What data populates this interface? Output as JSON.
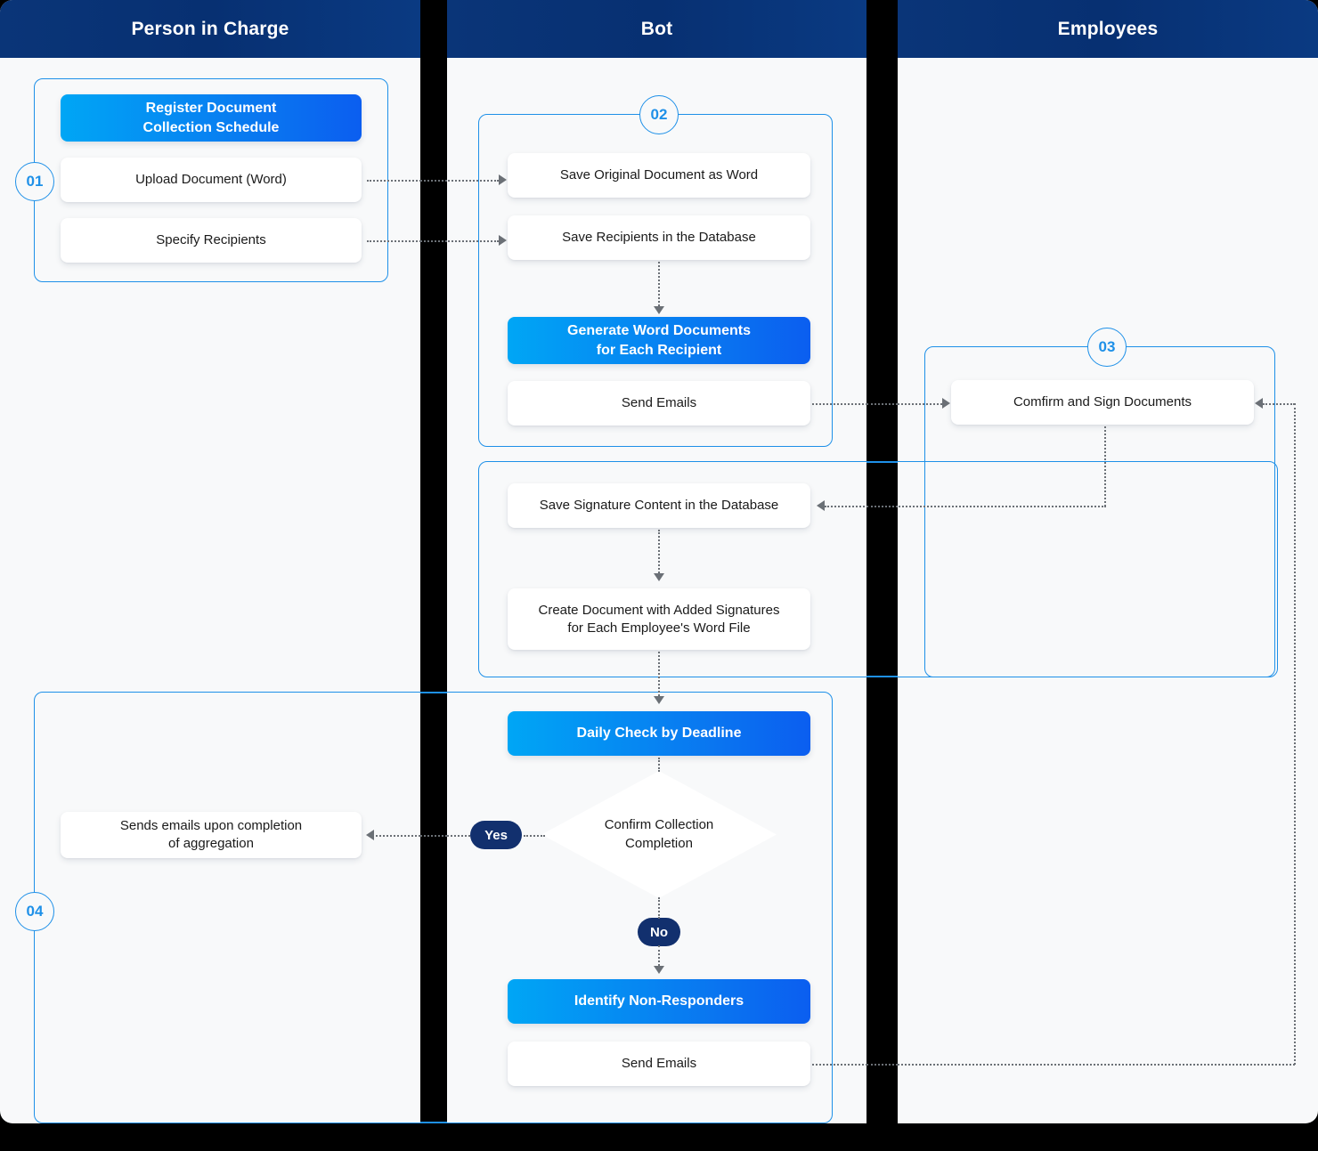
{
  "lanes": [
    {
      "id": "person-in-charge",
      "title": "Person in Charge"
    },
    {
      "id": "bot",
      "title": "Bot"
    },
    {
      "id": "employees",
      "title": "Employees"
    }
  ],
  "groups": [
    {
      "id": "g01",
      "number": "01"
    },
    {
      "id": "g02",
      "number": "02"
    },
    {
      "id": "g03",
      "number": "03"
    },
    {
      "id": "g04",
      "number": "04"
    }
  ],
  "nodes": {
    "register_schedule": "Register Document\nCollection Schedule",
    "upload_document": "Upload Document (Word)",
    "specify_recipients": "Specify Recipients",
    "save_original": "Save Original Document as Word",
    "save_recipients": "Save Recipients in the Database",
    "generate_docs": "Generate Word Documents\nfor Each Recipient",
    "send_emails_1": "Send Emails",
    "confirm_sign": "Comfirm and Sign Documents",
    "save_signature": "Save Signature Content in the Database",
    "create_document": "Create Document with Added Signatures\nfor Each Employee's Word File",
    "daily_check": "Daily Check by Deadline",
    "confirm_collection": "Confirm Collection\nCompletion",
    "identify_non_responders": "Identify Non-Responders",
    "send_emails_2": "Send Emails",
    "sends_emails_aggregation": "Sends emails upon completion\nof aggregation"
  },
  "decision_labels": {
    "yes": "Yes",
    "no": "No"
  },
  "colors": {
    "header_navy": "#073072",
    "accent_blue_start": "#00a6f5",
    "accent_blue_end": "#0b5ef0",
    "group_border": "#1e90e8",
    "pill_navy": "#12306e",
    "lane_background": "#f8f9fa",
    "connector_gray": "#6b7076"
  }
}
